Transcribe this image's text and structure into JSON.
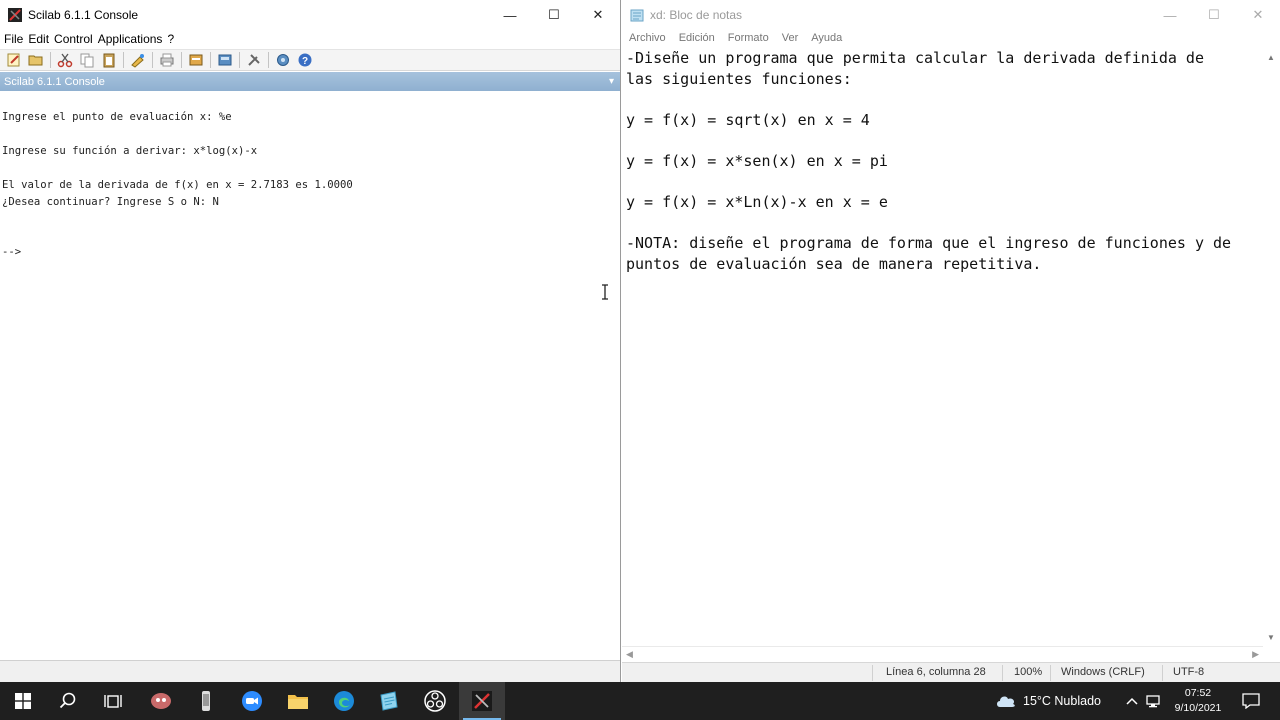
{
  "scilab": {
    "window_title": "Scilab 6.1.1 Console",
    "menu": [
      "File",
      "Edit",
      "Control",
      "Applications",
      "?"
    ],
    "console_header": "Scilab 6.1.1 Console",
    "console_lines": [
      "Ingrese el punto de evaluación x: %e",
      "Ingrese su función a derivar: x*log(x)-x",
      "El valor de la derivada de f(x) en x = 2.7183 es 1.0000",
      "¿Desea continuar? Ingrese S o N: N",
      "-->"
    ],
    "toolbar_icons": [
      "new-script-icon",
      "open-folder-icon",
      "cut-icon",
      "copy-icon",
      "paste-icon",
      "change-directory-icon",
      "print-icon",
      "browser-icon",
      "variable-editor-icon",
      "module-manager-icon",
      "preferences-icon",
      "demos-icon",
      "help-icon"
    ]
  },
  "notepad": {
    "window_title": "xd: Bloc de notas",
    "menu": [
      "Archivo",
      "Edición",
      "Formato",
      "Ver",
      "Ayuda"
    ],
    "text_lines": [
      "-Diseñe un programa que permita calcular la derivada definida de",
      "las siguientes funciones:",
      "",
      "y = f(x) = sqrt(x) en x = 4",
      "",
      "y = f(x) = x*sen(x) en x = pi",
      "",
      "y = f(x) = x*Ln(x)-x en x = e",
      "",
      "-NOTA: diseñe el programa de forma que el ingreso de funciones y de",
      "puntos de evaluación sea de manera repetitiva."
    ],
    "status": {
      "position": "Línea 6, columna 28",
      "zoom": "100%",
      "line_ending": "Windows (CRLF)",
      "encoding": "UTF-8"
    }
  },
  "taskbar": {
    "weather": "15°C Nublado",
    "time": "07:52",
    "date": "9/10/2021",
    "apps": [
      "start-icon",
      "search-icon",
      "task-view-icon",
      "app-icon-1",
      "app-icon-2",
      "zoom-icon",
      "file-explorer-icon",
      "edge-icon",
      "notepad-icon",
      "obs-icon",
      "scilab-icon"
    ]
  },
  "colors": {
    "console_header": "#9ab8d6",
    "taskbar": "#1f1f1f",
    "taskbar_accent": "#76b9ed"
  }
}
